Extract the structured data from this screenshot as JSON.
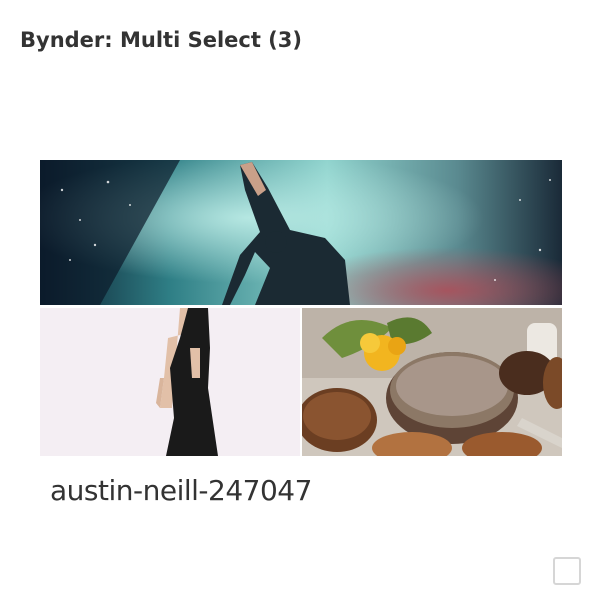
{
  "header": {
    "title": "Bynder: Multi Select (3)"
  },
  "selection": {
    "images": [
      {
        "icon": "concert-photo-icon"
      },
      {
        "icon": "fashion-photo-icon"
      },
      {
        "icon": "bread-photo-icon"
      }
    ],
    "caption": "austin-neill-247047"
  },
  "colors": {
    "text": "#333333",
    "checkbox_border": "#d6d6d6"
  }
}
